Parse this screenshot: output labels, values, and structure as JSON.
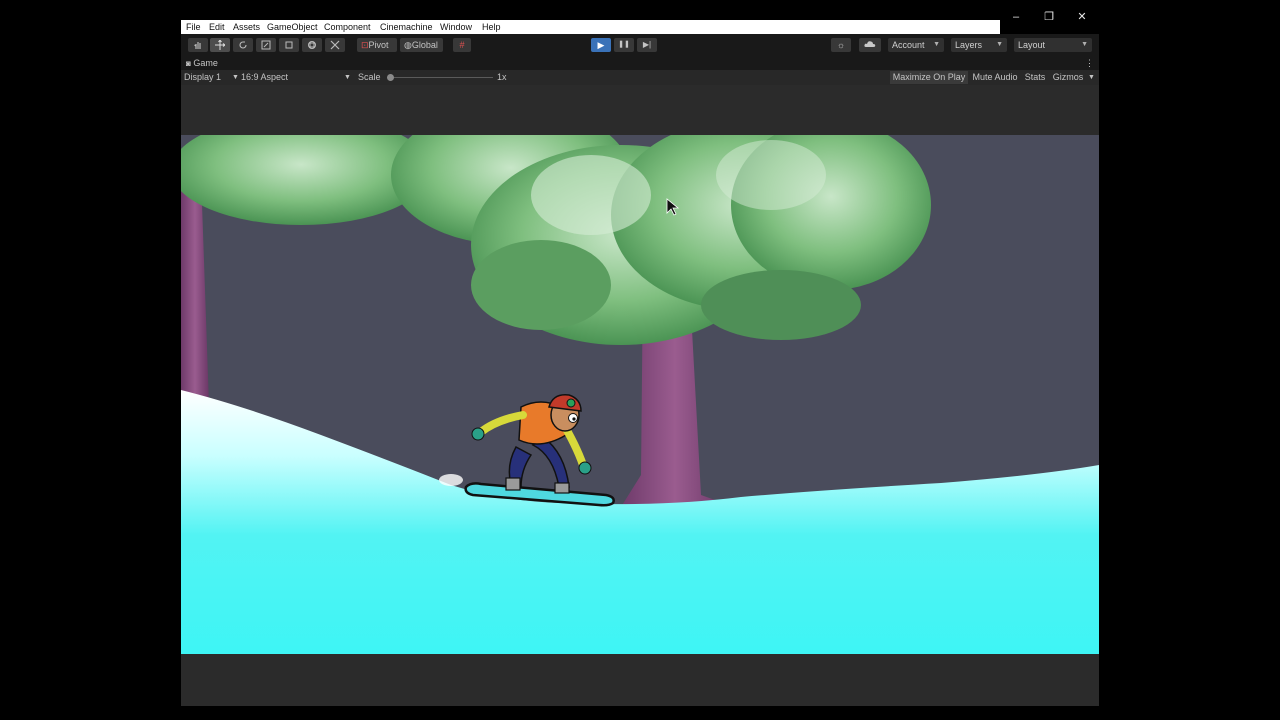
{
  "window": {
    "controls": {
      "minimize": "–",
      "restore": "❐",
      "close": "✕"
    }
  },
  "menu": [
    "File",
    "Edit",
    "Assets",
    "GameObject",
    "Component",
    "Cinemachine",
    "Window",
    "Help"
  ],
  "toolbar": {
    "tools": [
      "hand-tool",
      "move-tool",
      "rotate-tool",
      "scale-tool",
      "rect-tool",
      "transform-tool",
      "custom-tool"
    ],
    "pivot_label": "Pivot",
    "global_label": "Global",
    "play": "▶",
    "pause": "❚❚",
    "step": "▶|",
    "account_label": "Account",
    "layers_label": "Layers",
    "layout_label": "Layout"
  },
  "game_tab": {
    "title": "Game",
    "display": "Display 1",
    "aspect": "16:9 Aspect",
    "scale_label": "Scale",
    "scale_value": "1x",
    "scale_level": 0,
    "maximize_on_play": "Maximize On Play",
    "mute_audio": "Mute Audio",
    "stats": "Stats",
    "gizmos": "Gizmos"
  },
  "colors": {
    "editor_dark": "#191919",
    "snow": "#3ef5f5",
    "sky": "#4a4c5c",
    "foliage": "#6aa86a",
    "trunk": "#8a4f7f",
    "play_active": "#3a72b8"
  }
}
